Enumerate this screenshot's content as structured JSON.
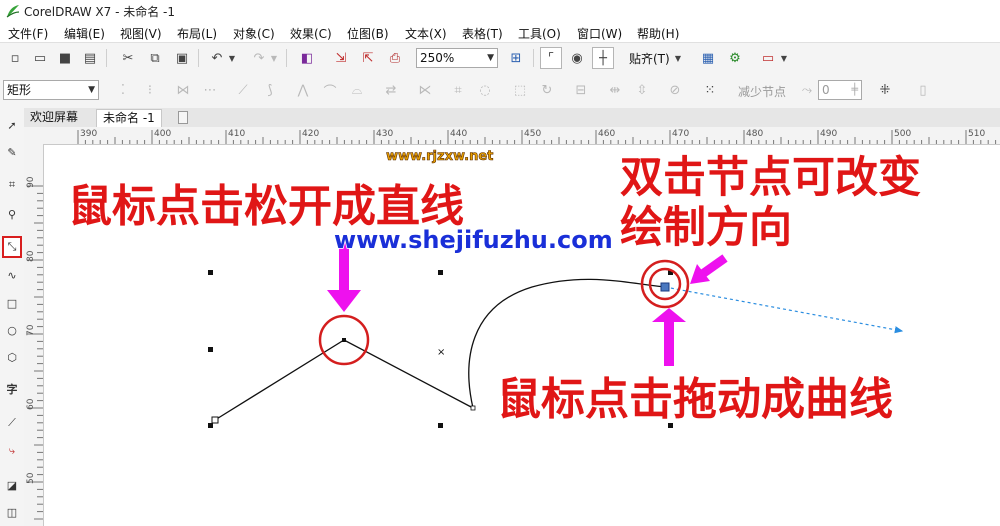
{
  "window": {
    "title": "CorelDRAW X7 - 未命名 -1"
  },
  "menu": [
    "文件(F)",
    "编辑(E)",
    "视图(V)",
    "布局(L)",
    "对象(C)",
    "效果(C)",
    "位图(B)",
    "文本(X)",
    "表格(T)",
    "工具(O)",
    "窗口(W)",
    "帮助(H)"
  ],
  "toolbar": {
    "zoom_value": "250%",
    "snap_label": "贴齐(T)"
  },
  "propbar": {
    "shape_select": "矩形",
    "reduce_nodes_label": "减少节点",
    "curve_smooth_value": "0"
  },
  "tabs": [
    "欢迎屏幕",
    "未命名 -1"
  ],
  "ruler": {
    "h_ticks": [
      "390",
      "400",
      "410",
      "420",
      "430",
      "440",
      "450",
      "460",
      "470",
      "480",
      "490",
      "500",
      "510"
    ],
    "v_ticks": [
      "90",
      "80",
      "70",
      "60",
      "50"
    ]
  },
  "annotations": {
    "left_caption": "鼠标点击松开成直线",
    "right_caption_line1": "双击节点可改变",
    "right_caption_line2": "绘制方向",
    "bottom_caption": "鼠标点击拖动成曲线"
  },
  "watermarks": {
    "site_a": "www.rjzxw.net",
    "site_b": "www.shejifuzhu.com"
  },
  "colors": {
    "annotation_red": "#e01616",
    "arrow_magenta": "#ee11ee",
    "watermark_blue": "#1a2fd8",
    "selected_tool_border": "#d81e1e"
  },
  "icons": {
    "toolbox": [
      "pick-tool-icon",
      "shape-tool-icon",
      "crop-tool-icon",
      "zoom-tool-icon",
      "freehand-tool-icon",
      "artistic-media-icon",
      "rectangle-tool-icon",
      "ellipse-tool-icon",
      "polygon-tool-icon",
      "text-tool-icon",
      "parallel-dimension-icon",
      "connector-tool-icon",
      "drop-shadow-icon",
      "transparency-icon"
    ]
  }
}
